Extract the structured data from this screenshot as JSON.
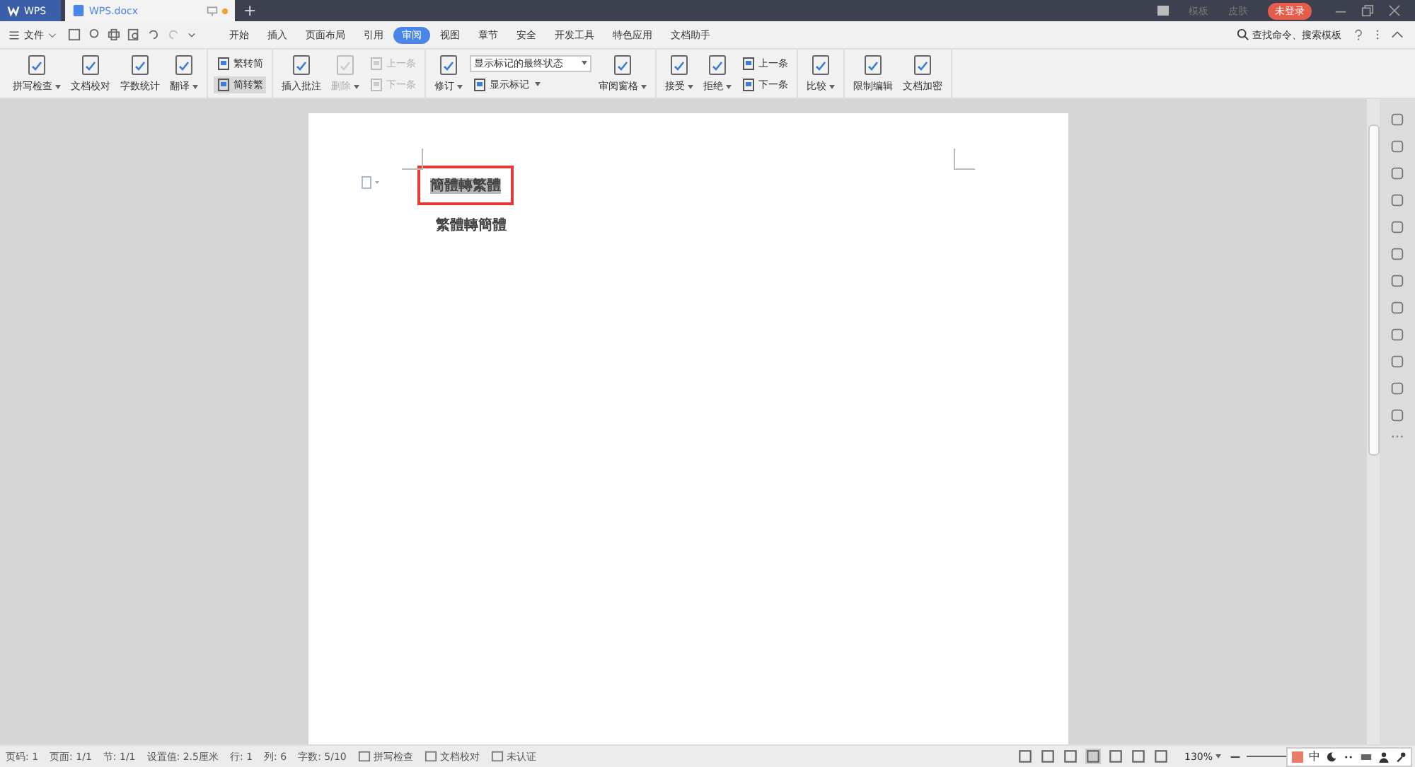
{
  "title_bar": {
    "app_tab": "WPS",
    "doc_tab": "WPS.docx",
    "new_tab": "+",
    "template": "模板",
    "skin": "皮肤",
    "login": "未登录"
  },
  "menu_bar": {
    "file": "文件",
    "tabs": [
      {
        "label": "开始",
        "selected": false
      },
      {
        "label": "插入",
        "selected": false
      },
      {
        "label": "页面布局",
        "selected": false
      },
      {
        "label": "引用",
        "selected": false
      },
      {
        "label": "审阅",
        "selected": true
      },
      {
        "label": "视图",
        "selected": false
      },
      {
        "label": "章节",
        "selected": false
      },
      {
        "label": "安全",
        "selected": false
      },
      {
        "label": "开发工具",
        "selected": false
      },
      {
        "label": "特色应用",
        "selected": false
      },
      {
        "label": "文档助手",
        "selected": false
      }
    ],
    "search": "查找命令、搜索模板"
  },
  "ribbon": [
    {
      "columns": [
        {
          "kind": "large",
          "label": "拼写检查",
          "caret": true,
          "disabled": false
        },
        {
          "kind": "large",
          "label": "文档校对",
          "caret": false,
          "disabled": false
        },
        {
          "kind": "large",
          "label": "字数统计",
          "caret": false,
          "disabled": false
        },
        {
          "kind": "large",
          "label": "翻译",
          "caret": true,
          "disabled": false
        }
      ]
    },
    {
      "columns": [
        {
          "kind": "stack",
          "items": [
            {
              "label": "繁转简",
              "caret": false,
              "disabled": false,
              "selected": false
            },
            {
              "label": "简转繁",
              "caret": false,
              "disabled": false,
              "selected": true
            }
          ]
        }
      ]
    },
    {
      "columns": [
        {
          "kind": "large",
          "label": "插入批注",
          "caret": false,
          "disabled": false
        },
        {
          "kind": "large",
          "label": "删除",
          "caret": true,
          "disabled": true
        },
        {
          "kind": "stack",
          "items": [
            {
              "label": "上一条",
              "caret": false,
              "disabled": true,
              "selected": false
            },
            {
              "label": "下一条",
              "caret": false,
              "disabled": true,
              "selected": false
            }
          ]
        }
      ]
    },
    {
      "columns": [
        {
          "kind": "large",
          "label": "修订",
          "caret": true,
          "disabled": false
        },
        {
          "kind": "select",
          "value": "显示标记的最终状态",
          "items": [
            {
              "label": "显示标记",
              "caret": true,
              "disabled": false,
              "selected": false
            }
          ]
        },
        {
          "kind": "large",
          "label": "审阅窗格",
          "caret": true,
          "disabled": false
        }
      ]
    },
    {
      "columns": [
        {
          "kind": "large",
          "label": "接受",
          "caret": true,
          "disabled": false
        },
        {
          "kind": "large",
          "label": "拒绝",
          "caret": true,
          "disabled": false
        },
        {
          "kind": "stack",
          "items": [
            {
              "label": "上一条",
              "caret": false,
              "disabled": false,
              "selected": false
            },
            {
              "label": "下一条",
              "caret": false,
              "disabled": false,
              "selected": false
            }
          ]
        }
      ]
    },
    {
      "columns": [
        {
          "kind": "large",
          "label": "比较",
          "caret": true,
          "disabled": false
        }
      ]
    },
    {
      "columns": [
        {
          "kind": "large",
          "label": "限制编辑",
          "caret": false,
          "disabled": false
        },
        {
          "kind": "large",
          "label": "文档加密",
          "caret": false,
          "disabled": false
        }
      ]
    }
  ],
  "document": {
    "paragraphs": [
      {
        "text": "簡體轉繁體",
        "selected": true
      },
      {
        "text": "繁體轉簡體",
        "selected": false
      }
    ]
  },
  "status_bar": {
    "items": [
      "页码: 1",
      "页面: 1/1",
      "节: 1/1",
      "设置值: 2.5厘米",
      "行: 1",
      "列: 6",
      "字数: 5/10"
    ],
    "tools": [
      "拼写检查",
      "文档校对",
      "未认证"
    ],
    "zoom": "130%",
    "ime": "中"
  }
}
